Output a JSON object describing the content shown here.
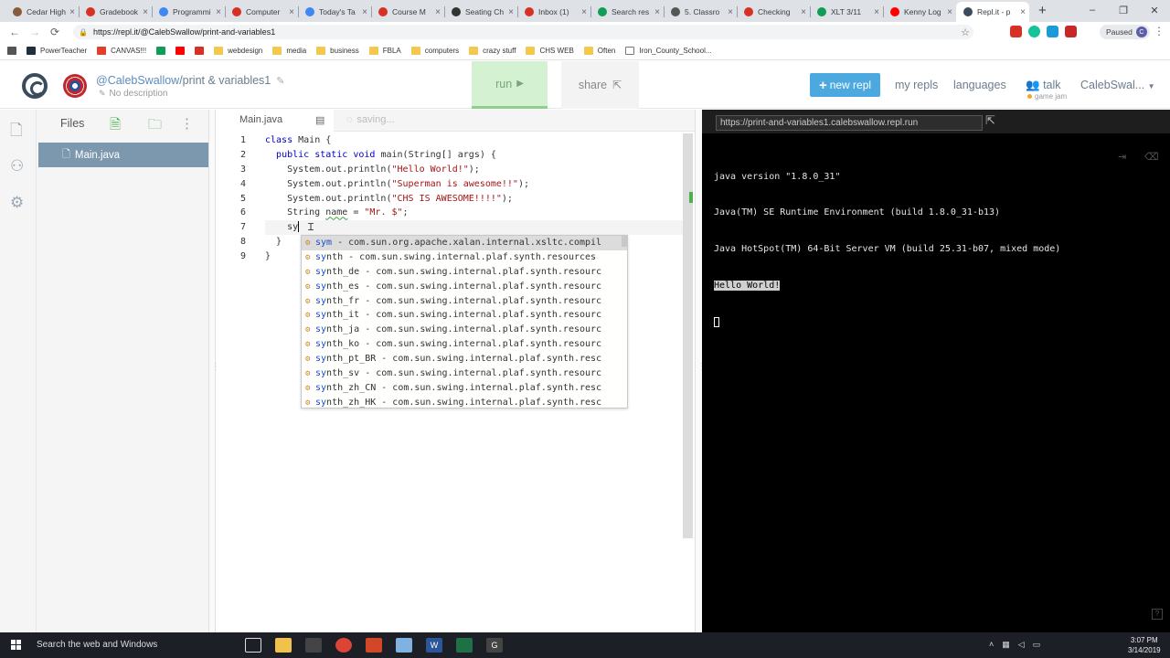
{
  "browser": {
    "tabs": [
      {
        "label": "Cedar High",
        "color": "#8a5a3c"
      },
      {
        "label": "Gradebook",
        "color": "#d93025"
      },
      {
        "label": "Programmi",
        "color": "#4285f4"
      },
      {
        "label": "Computer",
        "color": "#d93025"
      },
      {
        "label": "Today's Ta",
        "color": "#4285f4"
      },
      {
        "label": "Course M",
        "color": "#d93025"
      },
      {
        "label": "Seating Ch",
        "color": "#333333"
      },
      {
        "label": "Inbox (1)",
        "color": "#d93025"
      },
      {
        "label": "Search res",
        "color": "#0f9d58"
      },
      {
        "label": "5. Classro",
        "color": "#555555"
      },
      {
        "label": "Checking",
        "color": "#d93025"
      },
      {
        "label": "XLT 3/11",
        "color": "#0f9d58"
      },
      {
        "label": "Kenny Log",
        "color": "#ff0000"
      },
      {
        "label": "Repl.it - p",
        "color": "#3a4b5c"
      }
    ],
    "new_tab": "+",
    "window_controls": {
      "minimize": "–",
      "restore": "❐",
      "close": "✕"
    },
    "url": "https://repl.it/@CalebSwallow/print-and-variables1",
    "profile_status": "Paused",
    "profile_initial": "C",
    "bookmarks": [
      {
        "label": "",
        "icon": "apps-icon"
      },
      {
        "label": "PowerTeacher",
        "icon": "powerteacher-icon"
      },
      {
        "label": "CANVAS!!!",
        "icon": "canvas-icon"
      },
      {
        "label": "",
        "icon": "drive-icon"
      },
      {
        "label": "",
        "icon": "youtube-icon"
      },
      {
        "label": "",
        "icon": "gmail-icon"
      },
      {
        "label": "webdesign",
        "icon": "folder-icon"
      },
      {
        "label": "media",
        "icon": "folder-icon"
      },
      {
        "label": "business",
        "icon": "folder-icon"
      },
      {
        "label": "FBLA",
        "icon": "folder-icon"
      },
      {
        "label": "computers",
        "icon": "folder-icon"
      },
      {
        "label": "crazy stuff",
        "icon": "folder-icon"
      },
      {
        "label": "CHS WEB",
        "icon": "folder-icon"
      },
      {
        "label": "Often",
        "icon": "folder-icon"
      },
      {
        "label": "Iron_County_School...",
        "icon": "page-icon"
      }
    ]
  },
  "header": {
    "username": "@CalebSwallow",
    "replname": "/print & variables1",
    "description": "No description",
    "run_label": "run",
    "share_label": "share",
    "new_repl_label": "new repl",
    "nav": {
      "my_repls": "my repls",
      "languages": "languages",
      "talk": "talk",
      "user": "CalebSwal..."
    },
    "talk_sub": "game jam"
  },
  "files": {
    "title": "Files",
    "items": [
      {
        "name": "Main.java"
      }
    ]
  },
  "editor": {
    "tab": "Main.java",
    "status": "saving...",
    "line_numbers": [
      "1",
      "2",
      "3",
      "4",
      "5",
      "6",
      "7",
      "8",
      "9"
    ],
    "autocomplete": [
      {
        "match": "sym",
        "rest": " - com.sun.org.apache.xalan.internal.xsltc.compil"
      },
      {
        "match": "sy",
        "rest": "nth - com.sun.swing.internal.plaf.synth.resources"
      },
      {
        "match": "sy",
        "rest": "nth_de - com.sun.swing.internal.plaf.synth.resourc"
      },
      {
        "match": "sy",
        "rest": "nth_es - com.sun.swing.internal.plaf.synth.resourc"
      },
      {
        "match": "sy",
        "rest": "nth_fr - com.sun.swing.internal.plaf.synth.resourc"
      },
      {
        "match": "sy",
        "rest": "nth_it - com.sun.swing.internal.plaf.synth.resourc"
      },
      {
        "match": "sy",
        "rest": "nth_ja - com.sun.swing.internal.plaf.synth.resourc"
      },
      {
        "match": "sy",
        "rest": "nth_ko - com.sun.swing.internal.plaf.synth.resourc"
      },
      {
        "match": "sy",
        "rest": "nth_pt_BR - com.sun.swing.internal.plaf.synth.resc"
      },
      {
        "match": "sy",
        "rest": "nth_sv - com.sun.swing.internal.plaf.synth.resourc"
      },
      {
        "match": "sy",
        "rest": "nth_zh_CN - com.sun.swing.internal.plaf.synth.resc"
      },
      {
        "match": "sy",
        "rest": "nth_zh_HK - com.sun.swing.internal.plaf.synth.resc"
      }
    ]
  },
  "console": {
    "url": "https://print-and-variables1.calebswallow.repl.run",
    "lines": [
      "java version \"1.8.0_31\"",
      "Java(TM) SE Runtime Environment (build 1.8.0_31-b13)",
      "Java HotSpot(TM) 64-Bit Server VM (build 25.31-b07, mixed mode)"
    ],
    "highlighted": "Hello World!"
  },
  "taskbar": {
    "search": "Search the web and Windows",
    "time": "3:07 PM",
    "date": "3/14/2019"
  }
}
